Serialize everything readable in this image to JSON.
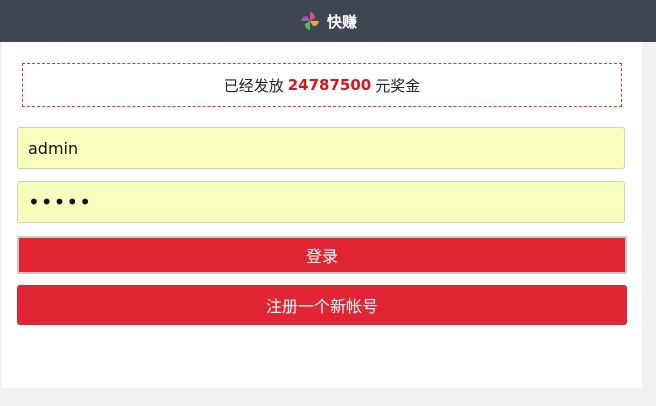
{
  "header": {
    "title": "快赚",
    "logo_icon": "pinwheel-logo-icon"
  },
  "notice": {
    "prefix": "已经发放",
    "amount": "24787500",
    "suffix": "元奖金"
  },
  "login_form": {
    "username_value": "admin",
    "password_value": "admin",
    "login_label": "登录",
    "register_label": "注册一个新帐号"
  },
  "colors": {
    "header_bg": "#3e4651",
    "accent_red": "#e12534",
    "autofill_yellow": "#faffbd"
  }
}
